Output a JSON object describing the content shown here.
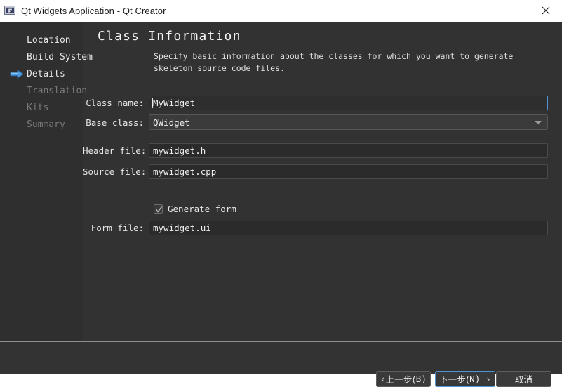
{
  "window": {
    "title": "Qt Widgets Application - Qt Creator",
    "app_icon": "qt-creator-icon",
    "close_label": "×"
  },
  "sidebar": {
    "items": [
      {
        "label": "Location",
        "state": "done",
        "arrow": false
      },
      {
        "label": "Build System",
        "state": "done",
        "arrow": false
      },
      {
        "label": "Details",
        "state": "current",
        "arrow": true
      },
      {
        "label": "Translation",
        "state": "pending",
        "arrow": false
      },
      {
        "label": "Kits",
        "state": "pending",
        "arrow": false
      },
      {
        "label": "Summary",
        "state": "pending",
        "arrow": false
      }
    ]
  },
  "page": {
    "title": "Class Information",
    "description": "Specify basic information about the classes for which you want to generate skeleton source code files."
  },
  "form": {
    "class_name": {
      "label": "Class name:",
      "value": "MyWidget",
      "focused": true
    },
    "base_class": {
      "label": "Base class:",
      "value": "QWidget",
      "type": "combobox",
      "arrow_icon": "chevron-down-icon"
    },
    "header_file": {
      "label": "Header file:",
      "value": "mywidget.h"
    },
    "source_file": {
      "label": "Source file:",
      "value": "mywidget.cpp"
    },
    "generate_form": {
      "label": "Generate form",
      "checked": true
    },
    "form_file": {
      "label": "Form file:",
      "value": "mywidget.ui"
    }
  },
  "footer": {
    "back_button": {
      "prefix": "‹ ",
      "text": "上一步(",
      "mnemonic": "B",
      "suffix": ")"
    },
    "next_button": {
      "text": "下一步(",
      "mnemonic": "N",
      "suffix": ") ›",
      "is_default": true
    },
    "cancel_button": {
      "text": "取消"
    }
  },
  "colors": {
    "titlebar_bg": "#ffffff",
    "dialog_bg": "#333333",
    "sidebar_bg": "#2f2f2f",
    "accent_blue": "#4d94d6",
    "text": "#e8e8e8",
    "text_dim": "#7a7a7a"
  }
}
